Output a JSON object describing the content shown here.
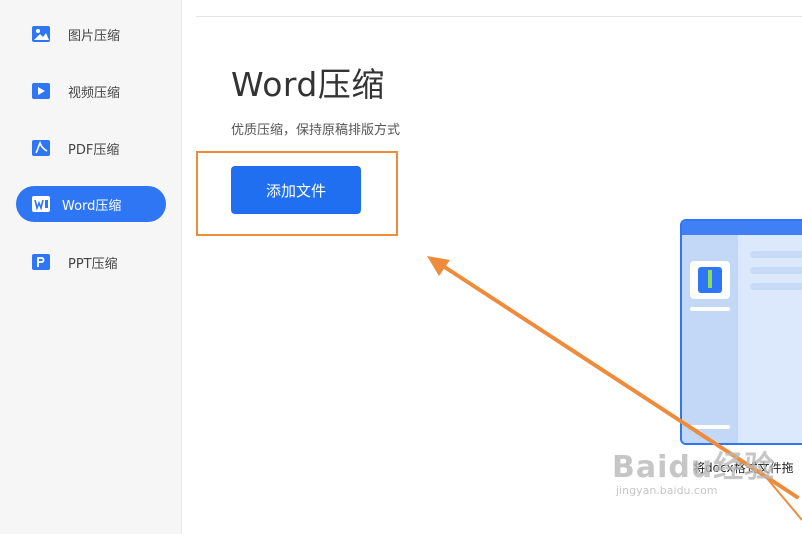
{
  "sidebar": {
    "items": [
      {
        "label": "图片压缩",
        "icon": "image-compress-icon",
        "active": false
      },
      {
        "label": "视频压缩",
        "icon": "video-compress-icon",
        "active": false
      },
      {
        "label": "PDF压缩",
        "icon": "pdf-compress-icon",
        "active": false
      },
      {
        "label": "Word压缩",
        "icon": "word-compress-icon",
        "active": true
      },
      {
        "label": "PPT压缩",
        "icon": "ppt-compress-icon",
        "active": false
      }
    ]
  },
  "main": {
    "title": "Word压缩",
    "subtitle": "优质压缩，保持原稿排版方式",
    "add_button": "添加文件",
    "illustration_caption": "将docx格式文件拖"
  },
  "watermark": {
    "main": "Baidu经验",
    "sub": "jingyan.baidu.com"
  },
  "colors": {
    "accent": "#2e76f3",
    "button": "#1f6ff0",
    "annotation": "#ee8c3c",
    "sidebar_bg": "#f6f6f6"
  }
}
